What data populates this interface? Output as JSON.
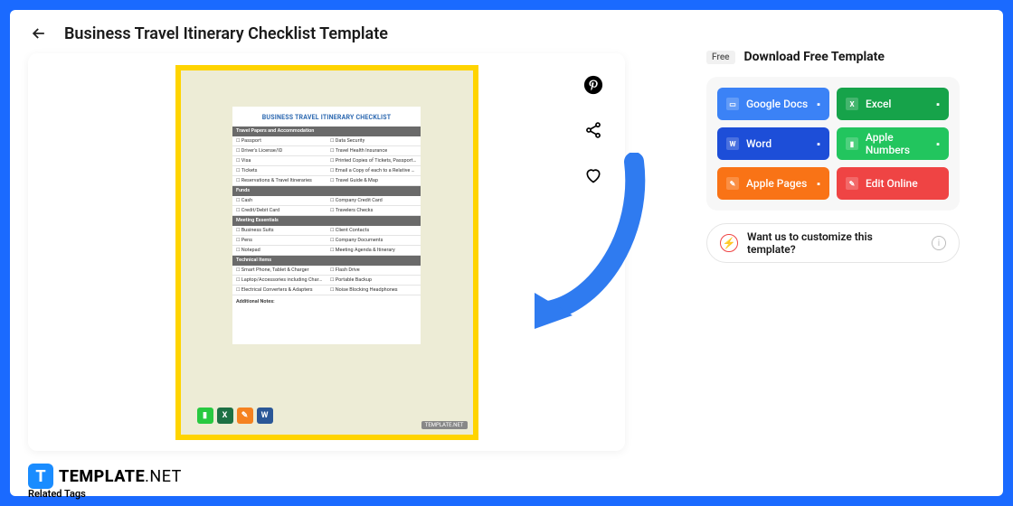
{
  "header": {
    "title": "Business Travel Itinerary Checklist Template"
  },
  "download": {
    "free_badge": "Free",
    "title": "Download Free Template",
    "buttons": {
      "google_docs": "Google Docs",
      "excel": "Excel",
      "word": "Word",
      "apple_numbers": "Apple Numbers",
      "apple_pages": "Apple Pages",
      "edit_online": "Edit Online"
    }
  },
  "customize": {
    "text": "Want us to customize this template?"
  },
  "preview": {
    "doc_title": "BUSINESS TRAVEL ITINERARY CHECKLIST",
    "sections": [
      {
        "heading": "Travel Papers and Accommodation",
        "rows": [
          [
            "Passport",
            "Data Security"
          ],
          [
            "Driver's License/ID",
            "Travel Health Insurance"
          ],
          [
            "Visa",
            "Printed Copies of Tickets, Passports, Emergency Information & Hotel Documents"
          ],
          [
            "Tickets",
            "Email a Copy of each to a Relative or Friend"
          ],
          [
            "Reservations & Travel Itineraries",
            "Travel Guide & Map"
          ]
        ]
      },
      {
        "heading": "Funds",
        "rows": [
          [
            "Cash",
            "Company Credit Card"
          ],
          [
            "Credit/Debit Card",
            "Travelers Checks"
          ]
        ]
      },
      {
        "heading": "Meeting Essentials",
        "rows": [
          [
            "Business Suits",
            "Client Contacts"
          ],
          [
            "Pens",
            "Company Documents"
          ],
          [
            "Notepad",
            "Meeting Agenda & Itinerary"
          ]
        ]
      },
      {
        "heading": "Technical Items",
        "rows": [
          [
            "Smart Phone, Tablet & Charger",
            "Flash Drive"
          ],
          [
            "Laptop/Accessories including Charger",
            "Portable Backup"
          ],
          [
            "Electrical Converters & Adapters",
            "Noise Blocking Headphones"
          ]
        ]
      }
    ],
    "notes_label": "Additional Notes:",
    "badge": "TEMPLATE.NET"
  },
  "footer": {
    "logo_text_bold": "TEMPLATE",
    "logo_text_light": ".NET",
    "related": "Related Tags"
  }
}
